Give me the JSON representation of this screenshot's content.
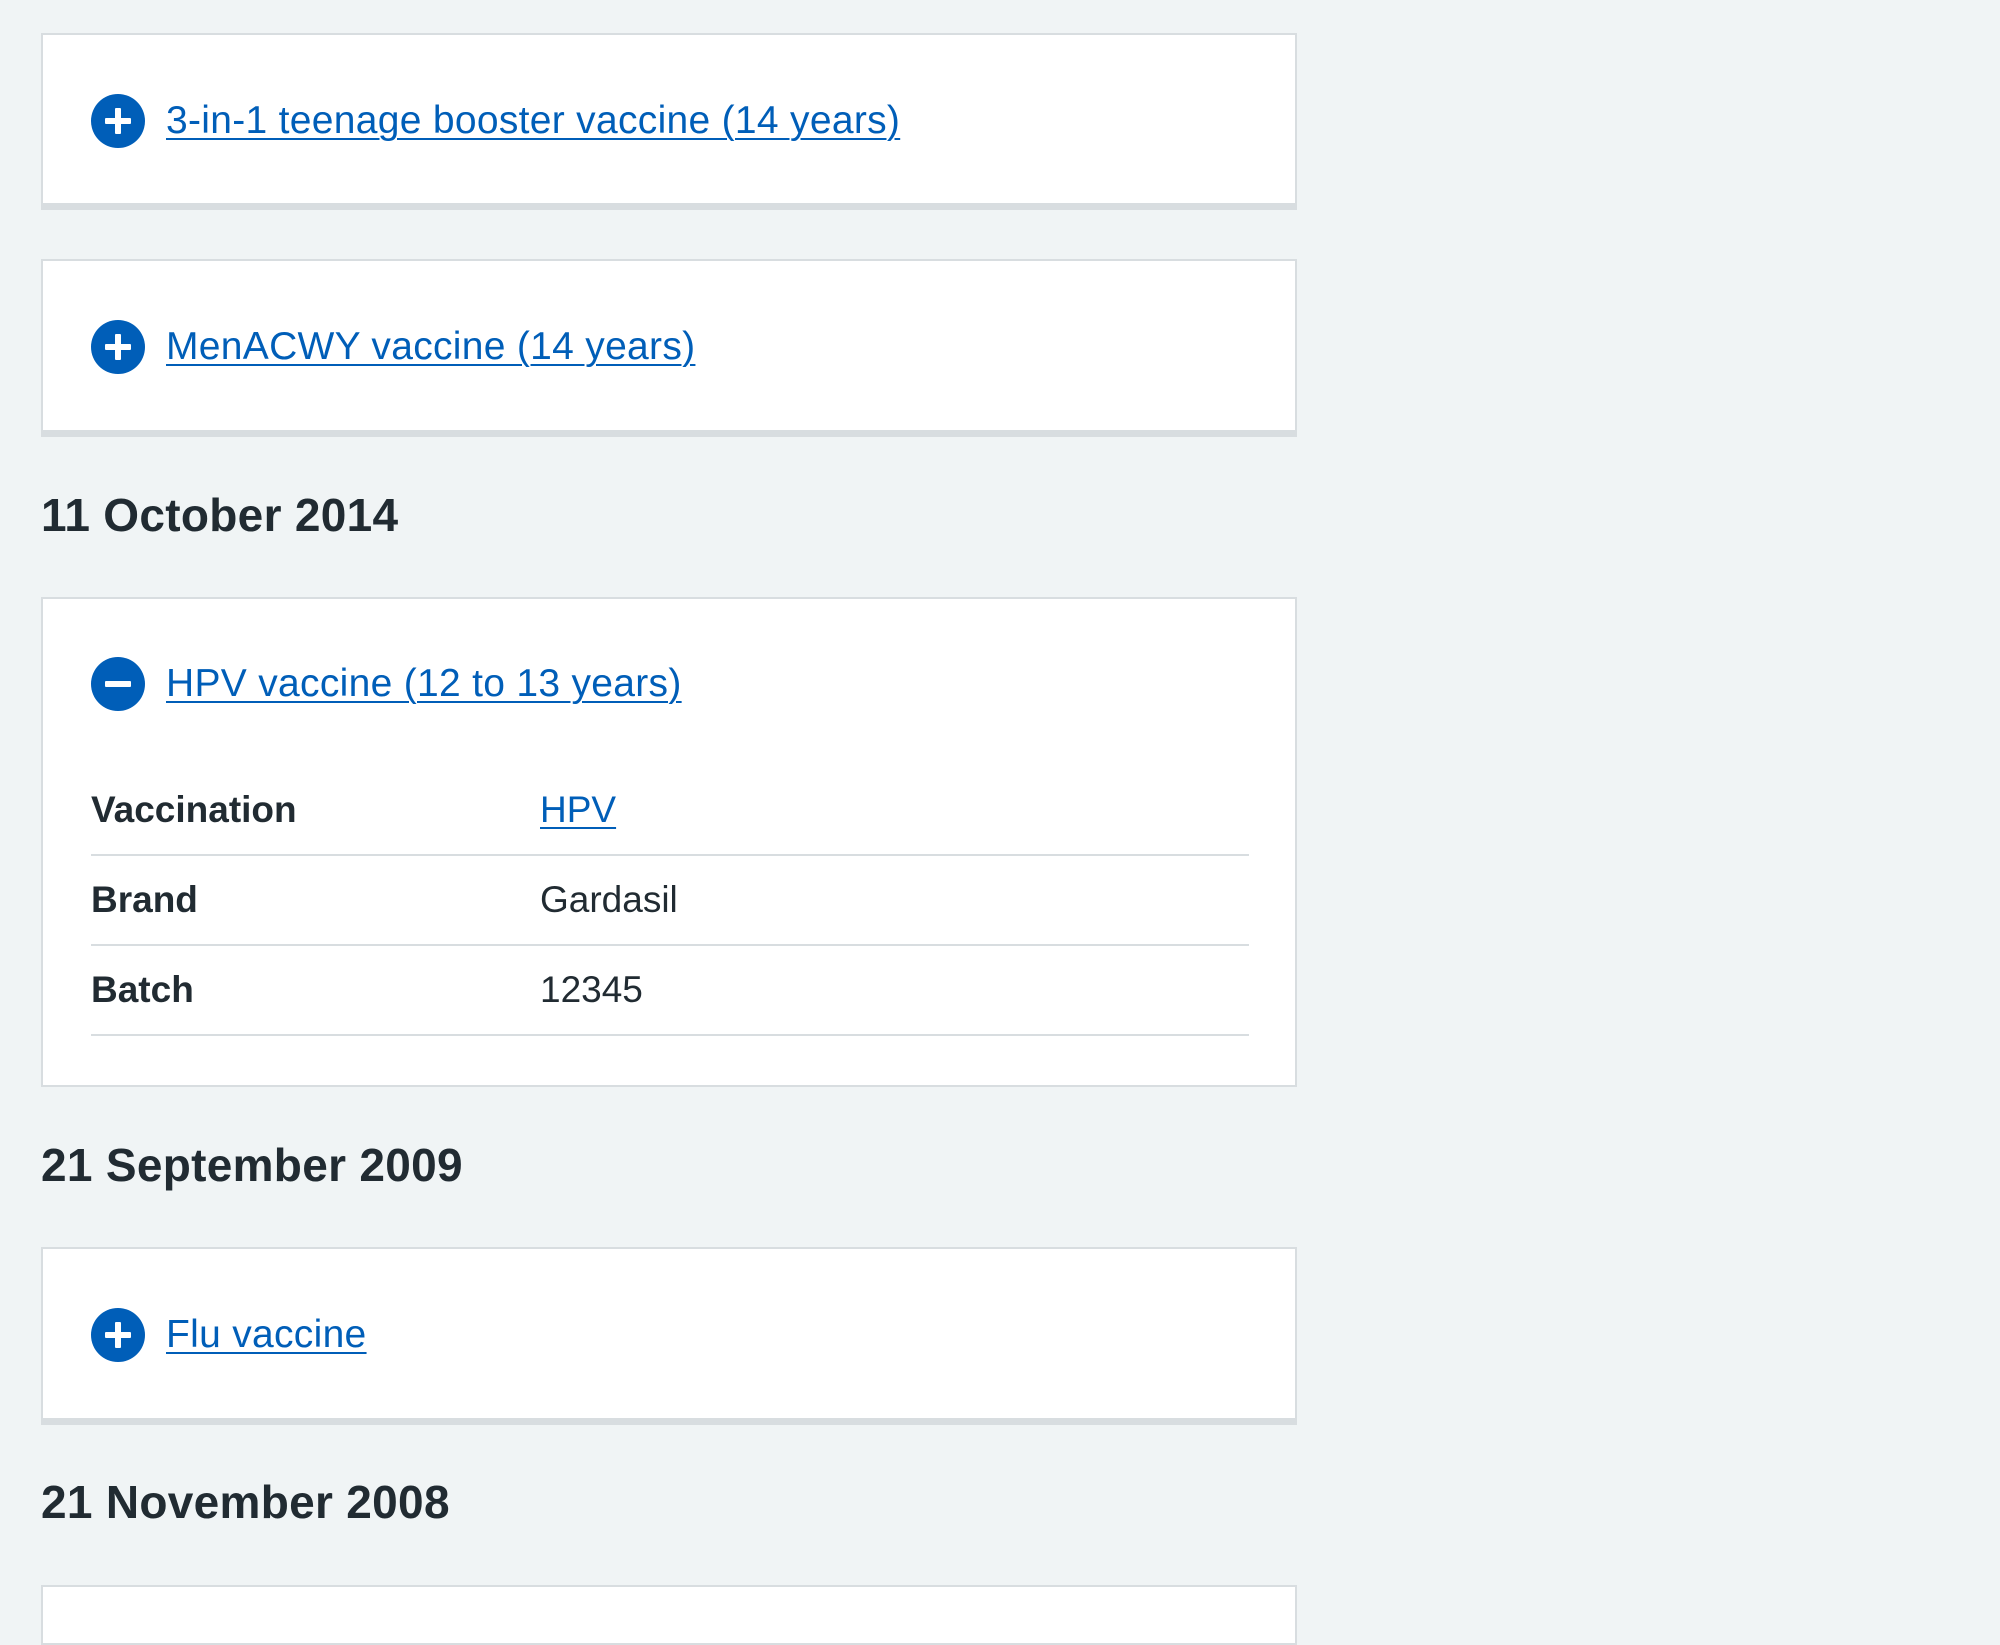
{
  "accent_color": "#005eb8",
  "background_color": "#f0f4f5",
  "groups": [
    {
      "items": [
        {
          "label": "3-in-1 teenage booster vaccine (14 years)",
          "state": "collapsed",
          "icon": "plus-icon"
        },
        {
          "label": "MenACWY vaccine (14 years)",
          "state": "collapsed",
          "icon": "plus-icon"
        }
      ]
    },
    {
      "date": "11 October 2014",
      "items": [
        {
          "label": "HPV vaccine (12 to 13 years)",
          "state": "expanded",
          "icon": "minus-icon",
          "details": [
            {
              "key": "Vaccination",
              "value": "HPV",
              "is_link": true
            },
            {
              "key": "Brand",
              "value": "Gardasil",
              "is_link": false
            },
            {
              "key": "Batch",
              "value": "12345",
              "is_link": false
            }
          ]
        }
      ]
    },
    {
      "date": "21 September 2009",
      "items": [
        {
          "label": "Flu vaccine",
          "state": "collapsed",
          "icon": "plus-icon"
        }
      ]
    },
    {
      "date": "21 November 2008",
      "items": []
    }
  ]
}
